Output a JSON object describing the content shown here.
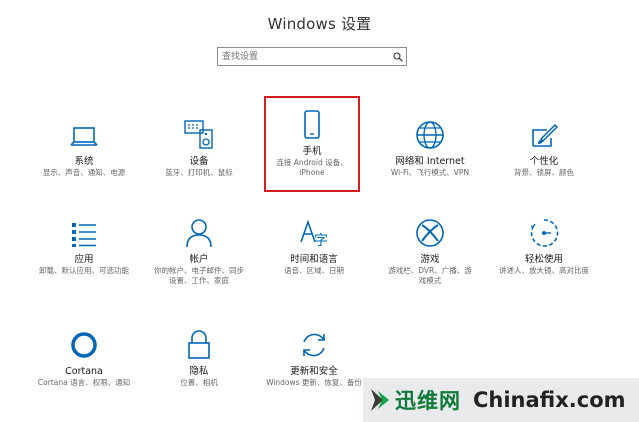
{
  "window": {
    "title": "Windows 设置"
  },
  "search": {
    "placeholder": "查找设置"
  },
  "tiles": [
    {
      "name": "系统",
      "desc": "显示、声音、通知、电源",
      "icon": "laptop-icon"
    },
    {
      "name": "设备",
      "desc": "蓝牙、打印机、鼠标",
      "icon": "devices-icon"
    },
    {
      "name": "手机",
      "desc": "连接 Android 设备、iPhone",
      "icon": "phone-icon"
    },
    {
      "name": "网络和 Internet",
      "desc": "Wi-Fi、飞行模式、VPN",
      "icon": "globe-icon"
    },
    {
      "name": "个性化",
      "desc": "背景、锁屏、颜色",
      "icon": "paint-icon"
    },
    {
      "name": "应用",
      "desc": "卸载、默认应用、可选功能",
      "icon": "apps-list-icon"
    },
    {
      "name": "帐户",
      "desc": "你的帐户、电子邮件、同步设置、工作、家庭",
      "icon": "person-icon"
    },
    {
      "name": "时间和语言",
      "desc": "语音、区域、日期",
      "icon": "language-icon"
    },
    {
      "name": "游戏",
      "desc": "游戏栏、DVR、广播、游戏模式",
      "icon": "xbox-icon"
    },
    {
      "name": "轻松使用",
      "desc": "讲述人、放大镜、高对比度",
      "icon": "ease-of-access-icon"
    },
    {
      "name": "Cortana",
      "desc": "Cortana 语言、权限、通知",
      "icon": "cortana-icon"
    },
    {
      "name": "隐私",
      "desc": "位置、相机",
      "icon": "lock-icon"
    },
    {
      "name": "更新和安全",
      "desc": "Windows 更新、恢复、备份",
      "icon": "sync-icon"
    }
  ],
  "watermark": {
    "cn": "迅维网",
    "en": "Chinafix.com"
  },
  "colors": {
    "accent": "#0067b8",
    "highlight": "#d21e1e",
    "watermark_green": "#0f7a3a"
  }
}
